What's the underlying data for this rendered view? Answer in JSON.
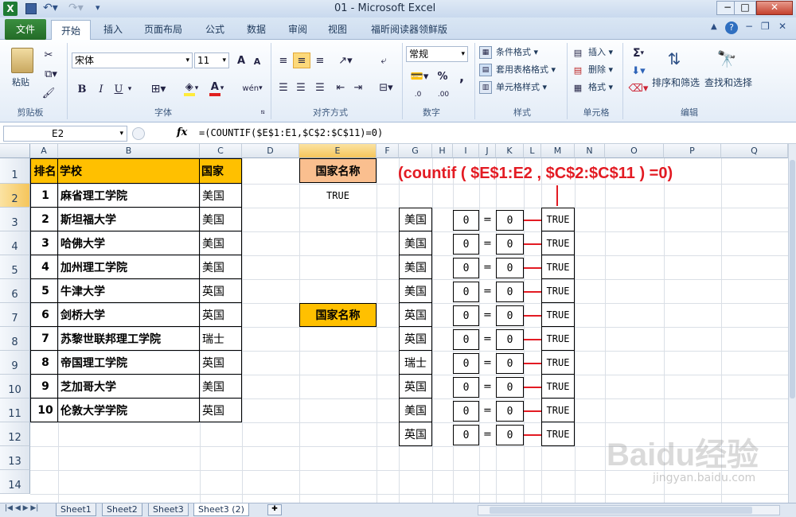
{
  "window": {
    "title": "01  -  Microsoft Excel"
  },
  "tabs": [
    "文件",
    "开始",
    "插入",
    "页面布局",
    "公式",
    "数据",
    "审阅",
    "视图",
    "福昕阅读器领鲜版"
  ],
  "ribbon": {
    "clipboard": {
      "paste": "粘贴",
      "group": "剪贴板"
    },
    "font": {
      "name": "宋体",
      "size": "11",
      "group": "字体",
      "bold": "B",
      "italic": "I",
      "underline": "U",
      "grow": "A",
      "shrink": "A",
      "fontcolor": "A",
      "wen": "wén"
    },
    "alignment": {
      "group": "对齐方式"
    },
    "number": {
      "format": "常规",
      "group": "数字",
      "percent": "%",
      "comma": ",",
      "inc": ".0",
      "dec": ".00"
    },
    "styles": {
      "cond": "条件格式",
      "table": "套用表格格式",
      "cell": "单元格样式",
      "group": "样式"
    },
    "cells": {
      "insert": "插入",
      "delete": "删除",
      "format": "格式",
      "group": "单元格"
    },
    "editing": {
      "sort": "排序和筛选",
      "find": "查找和选择",
      "group": "编辑",
      "sigma": "Σ"
    }
  },
  "formula_bar": {
    "cell_ref": "E2",
    "fx": "fx",
    "formula": "=(COUNTIF($E$1:E1,$C$2:$C$11)=0)"
  },
  "columns": [
    "A",
    "B",
    "C",
    "D",
    "E",
    "F",
    "G",
    "H",
    "I",
    "J",
    "K",
    "L",
    "M",
    "N",
    "O",
    "P",
    "Q"
  ],
  "rows": [
    "1",
    "2",
    "3",
    "4",
    "5",
    "6",
    "7",
    "8",
    "9",
    "10",
    "11",
    "12",
    "13",
    "14"
  ],
  "table": {
    "headers": [
      "排名",
      "学校",
      "国家"
    ],
    "rows": [
      [
        "1",
        "麻省理工学院",
        "美国"
      ],
      [
        "2",
        "斯坦福大学",
        "美国"
      ],
      [
        "3",
        "哈佛大学",
        "美国"
      ],
      [
        "4",
        "加州理工学院",
        "美国"
      ],
      [
        "5",
        "牛津大学",
        "英国"
      ],
      [
        "6",
        "剑桥大学",
        "英国"
      ],
      [
        "7",
        "苏黎世联邦理工学院",
        "瑞士"
      ],
      [
        "8",
        "帝国理工学院",
        "英国"
      ],
      [
        "9",
        "芝加哥大学",
        "美国"
      ],
      [
        "10",
        "伦敦大学学院",
        "英国"
      ]
    ]
  },
  "e_column": {
    "e1": "国家名称",
    "e2": "TRUE",
    "e7": "国家名称"
  },
  "annotation": "(countif ( $E$1:E2 , $C$2:$C$11 ) =0)",
  "g_values": [
    "美国",
    "美国",
    "美国",
    "美国",
    "英国",
    "英国",
    "瑞士",
    "英国",
    "美国",
    "英国"
  ],
  "i_values": [
    "0",
    "0",
    "0",
    "0",
    "0",
    "0",
    "0",
    "0",
    "0",
    "0"
  ],
  "j_values": [
    "=",
    "=",
    "=",
    "=",
    "=",
    "=",
    "=",
    "=",
    "=",
    "="
  ],
  "k_values": [
    "0",
    "0",
    "0",
    "0",
    "0",
    "0",
    "0",
    "0",
    "0",
    "0"
  ],
  "m_values": [
    "TRUE",
    "TRUE",
    "TRUE",
    "TRUE",
    "TRUE",
    "TRUE",
    "TRUE",
    "TRUE",
    "TRUE",
    "TRUE"
  ],
  "sheets": [
    "Sheet1",
    "Sheet2",
    "Sheet3",
    "Sheet3 (2)"
  ],
  "watermark": {
    "brand": "Baidu经验",
    "url": "jingyan.baidu.com"
  },
  "colors": {
    "header_fill": "#FFC000",
    "e1_fill": "#FABF8F",
    "annotation": "#E31B23",
    "file_tab": "#2E7D32"
  }
}
